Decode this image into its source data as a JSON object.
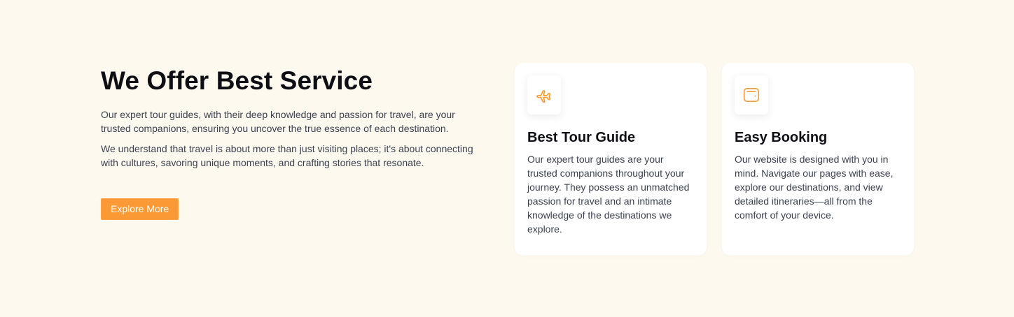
{
  "colors": {
    "background": "#fdf9ef",
    "accent": "#fb9a35",
    "card_background": "#ffffff",
    "heading": "#0d0f14",
    "body_text": "#3b4150"
  },
  "intro": {
    "title": "We Offer Best Service",
    "paragraphs": [
      "Our expert tour guides, with their deep knowledge and passion for travel, are your trusted companions, ensuring you uncover the true essence of each destination.",
      "We understand that travel is about more than just visiting places; it's about connecting with cultures, savoring unique moments, and crafting stories that resonate."
    ],
    "button_label": "Explore More"
  },
  "services": [
    {
      "icon": "airplane-icon",
      "title": "Best Tour Guide",
      "description": "Our expert tour guides are your trusted companions throughout your journey. They possess an unmatched passion for travel and an intimate knowledge of the destinations we explore."
    },
    {
      "icon": "wallet-icon",
      "title": "Easy Booking",
      "description": "Our website is designed with you in mind. Navigate our pages with ease, explore our destinations, and view detailed itineraries—all from the comfort of your device."
    }
  ]
}
